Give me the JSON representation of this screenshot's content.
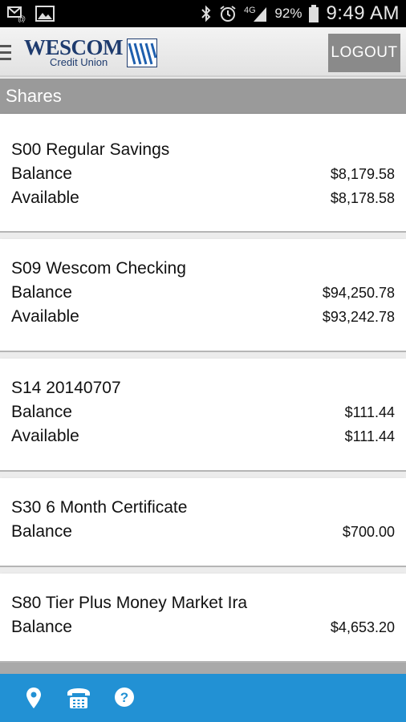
{
  "status_bar": {
    "battery_percent": "92%",
    "time": "9:49 AM",
    "network": "4G",
    "icons": [
      "email-notification-icon",
      "image-icon",
      "bluetooth-icon",
      "alarm-icon",
      "signal-icon",
      "battery-icon"
    ]
  },
  "header": {
    "logo_name": "WESCOM",
    "logo_sub": "Credit Union",
    "logout_label": "LOGOUT",
    "brand_color": "#1e3b6e"
  },
  "section": {
    "title": "Shares"
  },
  "accounts": [
    {
      "name": "S00 Regular Savings",
      "rows": [
        {
          "label": "Balance",
          "value": "$8,179.58"
        },
        {
          "label": "Available",
          "value": "$8,178.58"
        }
      ]
    },
    {
      "name": "S09 Wescom Checking",
      "rows": [
        {
          "label": "Balance",
          "value": "$94,250.78"
        },
        {
          "label": "Available",
          "value": "$93,242.78"
        }
      ]
    },
    {
      "name": "S14 20140707",
      "rows": [
        {
          "label": "Balance",
          "value": "$111.44"
        },
        {
          "label": "Available",
          "value": "$111.44"
        }
      ]
    },
    {
      "name": "S30 6 Month Certificate",
      "rows": [
        {
          "label": "Balance",
          "value": "$700.00"
        }
      ]
    },
    {
      "name": "S80 Tier Plus Money Market Ira",
      "rows": [
        {
          "label": "Balance",
          "value": "$4,653.20"
        }
      ]
    }
  ],
  "bottom_bar": {
    "color": "#2291d4",
    "icons": [
      "location-pin-icon",
      "phone-icon",
      "help-icon"
    ]
  }
}
